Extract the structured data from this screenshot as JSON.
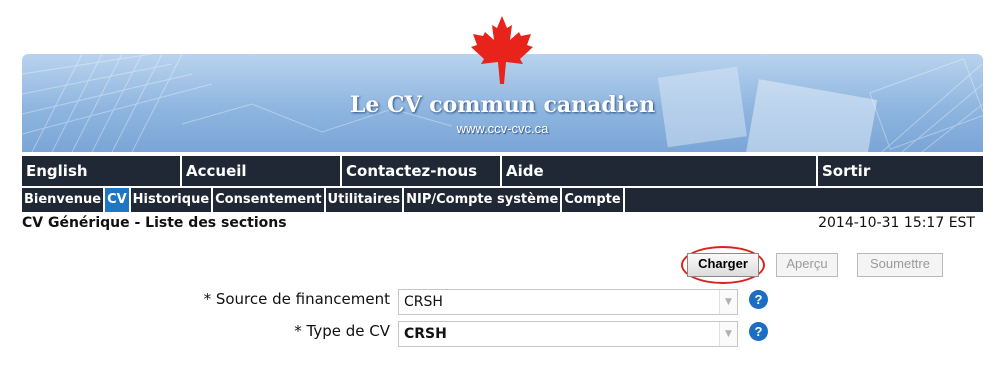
{
  "banner": {
    "title": "Le CV commun canadien",
    "url": "www.ccv-cvc.ca"
  },
  "topnav": [
    "English",
    "Accueil",
    "Contactez-nous",
    "Aide",
    "Sortir"
  ],
  "subnav": {
    "tabs": [
      "Bienvenue",
      "CV",
      "Historique",
      "Consentement",
      "Utilitaires",
      "NIP/Compte système",
      "Compte"
    ],
    "active": "CV"
  },
  "page": {
    "title": "CV Générique - Liste des sections",
    "datetime": "2014-10-31 15:17 EST"
  },
  "buttons": {
    "charger": "Charger",
    "apercu": "Aperçu",
    "soumettre": "Soumettre"
  },
  "form": {
    "funding_label": "* Source de financement",
    "funding_value": "CRSH",
    "cv_type_label": "* Type de CV",
    "cv_type_value": "CRSH",
    "help_glyph": "?"
  },
  "colors": {
    "nav_background": "#1f2834",
    "active_tab": "#1f77c4",
    "highlight": "#d9241c",
    "leaf": "#e8231b"
  }
}
